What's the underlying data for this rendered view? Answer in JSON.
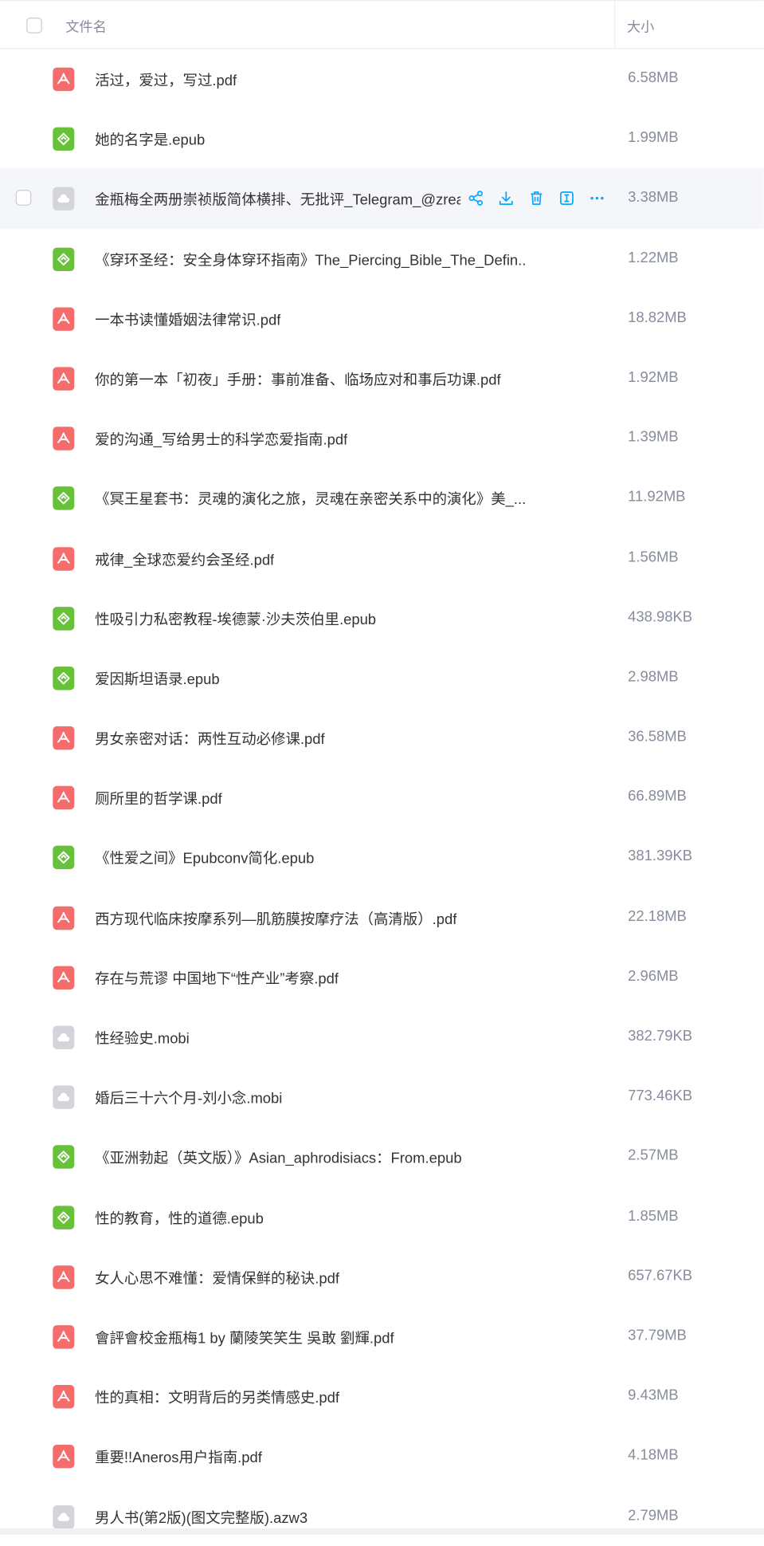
{
  "header": {
    "name_label": "文件名",
    "size_label": "大小"
  },
  "files": [
    {
      "name": "活过，爱过，写过.pdf",
      "size": "6.58MB",
      "type": "pdf"
    },
    {
      "name": "她的名字是.epub",
      "size": "1.99MB",
      "type": "epub"
    },
    {
      "name": "金瓶梅全两册崇祯版简体横排、无批评_Telegram_@zreac",
      "size": "3.38MB",
      "type": "other",
      "hover": true
    },
    {
      "name": "《穿环圣经：安全身体穿环指南》The_Piercing_Bible_The_Defin...",
      "size": "1.22MB",
      "type": "epub"
    },
    {
      "name": "一本书读懂婚姻法律常识.pdf",
      "size": "18.82MB",
      "type": "pdf"
    },
    {
      "name": "你的第一本「初夜」手册：事前准备、临场应对和事后功课.pdf",
      "size": "1.92MB",
      "type": "pdf"
    },
    {
      "name": "爱的沟通_写给男士的科学恋爱指南.pdf",
      "size": "1.39MB",
      "type": "pdf"
    },
    {
      "name": "《冥王星套书：灵魂的演化之旅，灵魂在亲密关系中的演化》美_...",
      "size": "11.92MB",
      "type": "epub"
    },
    {
      "name": "戒律_全球恋爱约会圣经.pdf",
      "size": "1.56MB",
      "type": "pdf"
    },
    {
      "name": "性吸引力私密教程-埃德蒙·沙夫茨伯里.epub",
      "size": "438.98KB",
      "type": "epub"
    },
    {
      "name": "爱因斯坦语录.epub",
      "size": "2.98MB",
      "type": "epub"
    },
    {
      "name": "男女亲密对话：两性互动必修课.pdf",
      "size": "36.58MB",
      "type": "pdf"
    },
    {
      "name": "厕所里的哲学课.pdf",
      "size": "66.89MB",
      "type": "pdf"
    },
    {
      "name": "《性爱之间》Epubconv简化.epub",
      "size": "381.39KB",
      "type": "epub"
    },
    {
      "name": "西方现代临床按摩系列—肌筋膜按摩疗法（高清版）.pdf",
      "size": "22.18MB",
      "type": "pdf"
    },
    {
      "name": "存在与荒谬 中国地下“性产业”考察.pdf",
      "size": "2.96MB",
      "type": "pdf"
    },
    {
      "name": "性经验史.mobi",
      "size": "382.79KB",
      "type": "other"
    },
    {
      "name": "婚后三十六个月-刘小念.mobi",
      "size": "773.46KB",
      "type": "other"
    },
    {
      "name": "《亚洲勃起（英文版）》Asian_aphrodisiacs：From.epub",
      "size": "2.57MB",
      "type": "epub"
    },
    {
      "name": "性的教育，性的道德.epub",
      "size": "1.85MB",
      "type": "epub"
    },
    {
      "name": "女人心思不难懂：爱情保鲜的秘诀.pdf",
      "size": "657.67KB",
      "type": "pdf"
    },
    {
      "name": "會評會校金瓶梅1 by 蘭陵笑笑生 吳敢 劉輝.pdf",
      "size": "37.79MB",
      "type": "pdf"
    },
    {
      "name": "性的真相：文明背后的另类情感史.pdf",
      "size": "9.43MB",
      "type": "pdf"
    },
    {
      "name": "重要!!Aneros用户指南.pdf",
      "size": "4.18MB",
      "type": "pdf"
    },
    {
      "name": "男人书(第2版)(图文完整版).azw3",
      "size": "2.79MB",
      "type": "other"
    }
  ],
  "icons": {
    "pdf": {
      "name": "pdf-file-icon",
      "color": "#f56c6c"
    },
    "epub": {
      "name": "epub-file-icon",
      "color": "#67c23a"
    },
    "other": {
      "name": "generic-file-icon",
      "color": "#d3d5db"
    }
  },
  "hover_actions": [
    "share-icon",
    "download-icon",
    "delete-icon",
    "rename-icon",
    "more-icon"
  ],
  "accent_color": "#06a7ff"
}
